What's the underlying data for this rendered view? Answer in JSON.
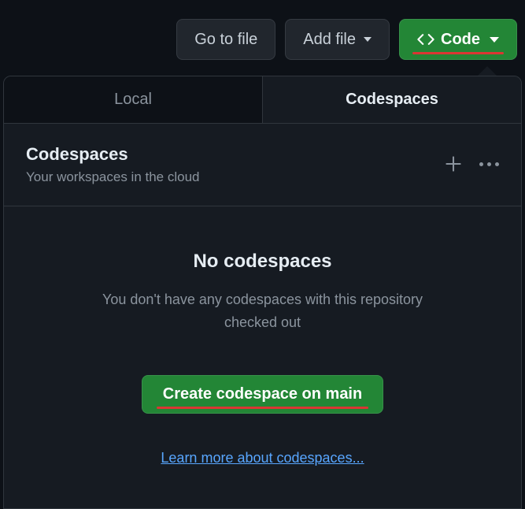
{
  "toolbar": {
    "go_to_file": "Go to file",
    "add_file": "Add file",
    "code": "Code"
  },
  "popover": {
    "tabs": {
      "local": "Local",
      "codespaces": "Codespaces"
    },
    "header": {
      "title": "Codespaces",
      "subtitle": "Your workspaces in the cloud"
    },
    "empty": {
      "title": "No codespaces",
      "description": "You don't have any codespaces with this repository checked out",
      "create_button": "Create codespace on main",
      "learn_more": "Learn more about codespaces..."
    }
  }
}
